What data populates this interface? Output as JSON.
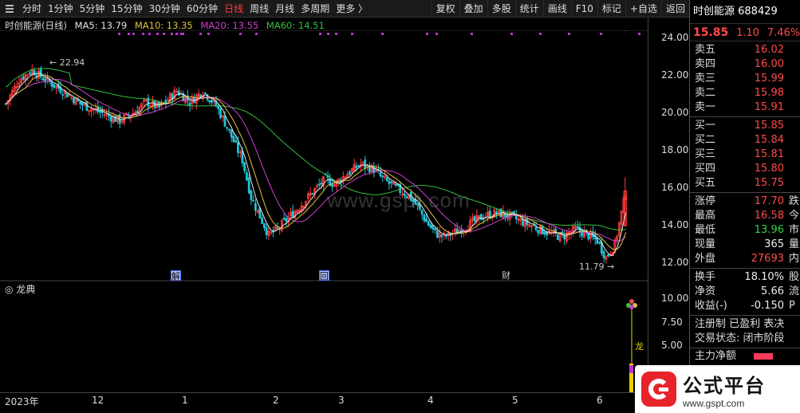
{
  "toolbar": {
    "tabs": [
      "分时",
      "1分钟",
      "5分钟",
      "15分钟",
      "30分钟",
      "60分钟",
      "日线",
      "周线",
      "月线",
      "多周期",
      "更多 〉"
    ],
    "active_tab": "日线",
    "tools": [
      "复权",
      "叠加",
      "多股",
      "统计",
      "画线",
      "F10",
      "标记",
      "+自选",
      "返回"
    ]
  },
  "chart_header": {
    "stock_label": "时创能源(日线)",
    "ma5": "MA5: 13.79",
    "ma10": "MA10: 13.35",
    "ma20": "MA20: 13.55",
    "ma60": "MA60: 14.51"
  },
  "colors": {
    "up": "#ff3b3b",
    "down": "#20c5d8",
    "ma5": "#e6e6e6",
    "ma10": "#e0c040",
    "ma20": "#d040d0",
    "ma60": "#30c040",
    "background": "#000000"
  },
  "y_axis": [
    "24.00",
    "22.00",
    "20.00",
    "18.00",
    "16.00",
    "14.00",
    "12.00"
  ],
  "sub_y_axis": [
    "10.00",
    "7.50",
    "5.00"
  ],
  "annotations": {
    "high": "22.94",
    "low": "11.79"
  },
  "events": [
    "解",
    "回",
    "财"
  ],
  "sub_panel": {
    "title": "龙典",
    "tag": "龙"
  },
  "x_axis": [
    "2023年",
    "12",
    "1",
    "2",
    "3",
    "4",
    "5",
    "6"
  ],
  "watermark": "www.gspt.com",
  "sidebar": {
    "name": "时创能源 688429",
    "price": "15.85",
    "change": "1.10",
    "pct": "7.46%",
    "asks": [
      {
        "label": "卖五",
        "price": "16.02"
      },
      {
        "label": "卖四",
        "price": "16.00"
      },
      {
        "label": "卖三",
        "price": "15.99"
      },
      {
        "label": "卖二",
        "price": "15.98"
      },
      {
        "label": "卖一",
        "price": "15.91"
      }
    ],
    "bids": [
      {
        "label": "买一",
        "price": "15.85"
      },
      {
        "label": "买二",
        "price": "15.84"
      },
      {
        "label": "买三",
        "price": "15.81"
      },
      {
        "label": "买四",
        "price": "15.80"
      },
      {
        "label": "买五",
        "price": "15.75"
      }
    ],
    "stats1": [
      {
        "label": "涨停",
        "value": "17.70",
        "tr": "跌"
      },
      {
        "label": "最高",
        "value": "16.58",
        "tr": "今"
      },
      {
        "label": "最低",
        "value": "13.96",
        "tr": "市"
      },
      {
        "label": "现量",
        "value": "365",
        "tr": "量"
      },
      {
        "label": "外盘",
        "value": "27693",
        "tr": "内"
      }
    ],
    "stats2": [
      {
        "label": "换手",
        "value": "18.10%",
        "tr": "股"
      },
      {
        "label": "净资",
        "value": "5.66",
        "tr": "流"
      },
      {
        "label": "收益(-)",
        "value": "-0.150",
        "tr": "P"
      }
    ],
    "info1": "注册制 已盈利 表决",
    "info2": "交易状态: 闭市阶段",
    "flow_label": "主力净额"
  },
  "logo": {
    "name": "公式平台",
    "url": "www.gspt.com"
  }
}
